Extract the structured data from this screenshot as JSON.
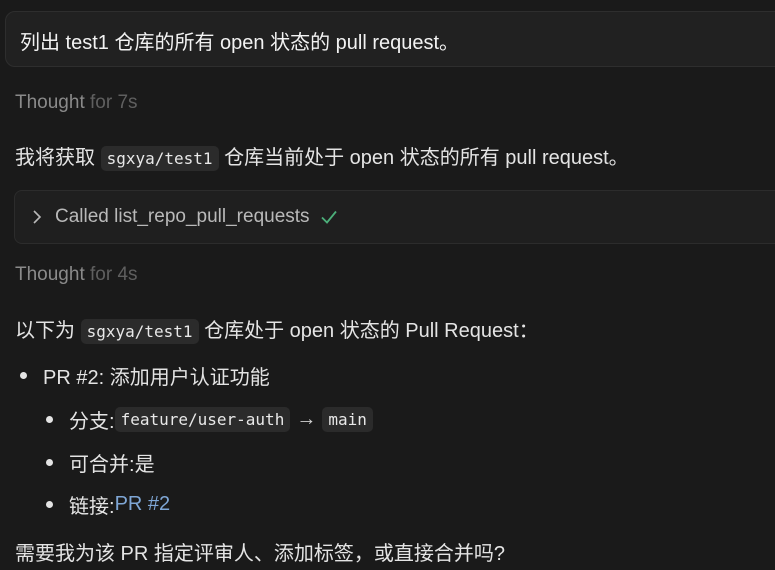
{
  "user_message": "列出 test1 仓库的所有 open 状态的 pull request。",
  "thought1": {
    "label": "Thought",
    "duration": "for 7s"
  },
  "para1": {
    "before": "我将获取 ",
    "code": "sgxya/test1",
    "after": " 仓库当前处于 open 状态的所有 pull request。"
  },
  "tool_call": {
    "label": "Called list_repo_pull_requests",
    "status_icon": "checkmark-icon",
    "status_color": "#4caf7a"
  },
  "thought2": {
    "label": "Thought",
    "duration": "for 4s"
  },
  "para2": {
    "before": "以下为 ",
    "code": "sgxya/test1",
    "after": " 仓库处于 open 状态的 Pull Request："
  },
  "pr": {
    "title": "PR #2: 添加用户认证功能",
    "branch_label": "分支: ",
    "source_branch": "feature/user-auth",
    "arrow": "→",
    "target_branch": "main",
    "mergeable_label": "可合并: ",
    "mergeable_value": "是",
    "link_label": "链接: ",
    "link_text": "PR #2",
    "link_color": "#7fa7d6"
  },
  "question": "需要我为该 PR 指定评审人、添加标签，或直接合并吗?"
}
